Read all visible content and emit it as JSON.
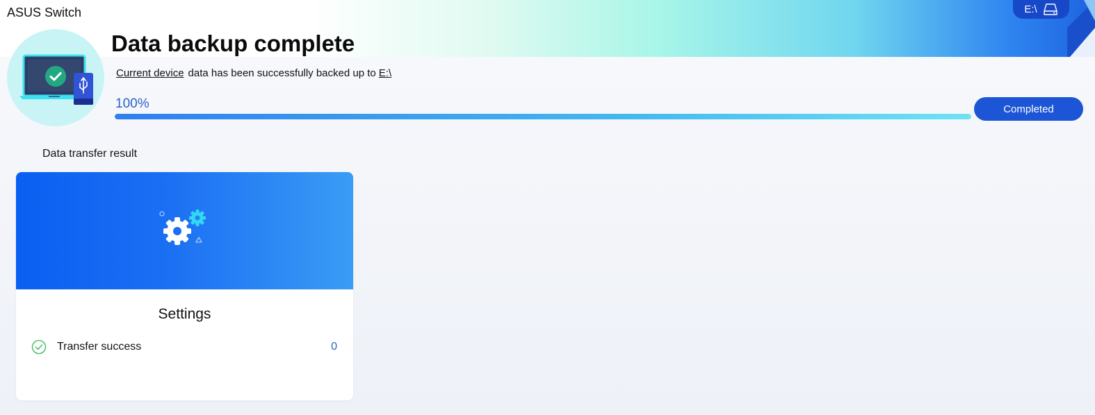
{
  "app": {
    "title": "ASUS Switch"
  },
  "drive": {
    "label": "E:\\"
  },
  "header": {
    "title": "Data backup complete",
    "source_link": "Current device",
    "message": "data has been successfully backed up to",
    "target_link": "E:\\"
  },
  "progress": {
    "label": "100%",
    "value": 100,
    "button_label": "Completed"
  },
  "result": {
    "section_title": "Data transfer result",
    "cards": [
      {
        "title": "Settings",
        "status_label": "Transfer success",
        "count": "0"
      }
    ]
  },
  "icons": {
    "drive": "hard-drive-icon",
    "laptop": "laptop-icon",
    "check": "check-circle-icon",
    "usb": "usb-drive-icon",
    "settings": "gears-icon"
  },
  "colors": {
    "accent": "#1c55d6",
    "progress_start": "#2f7ff0",
    "progress_end": "#6fe3f3",
    "success": "#4cc06a",
    "count": "#2a62c9"
  }
}
